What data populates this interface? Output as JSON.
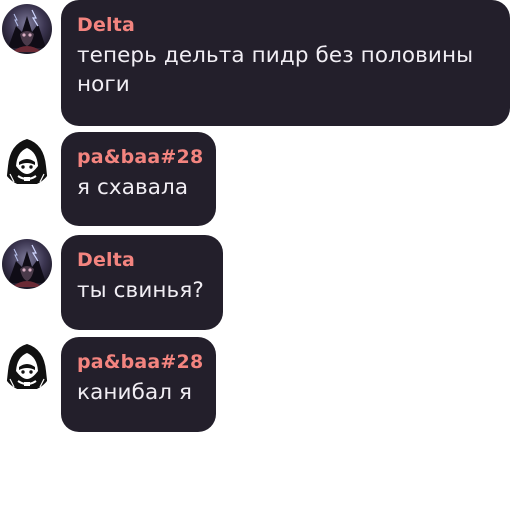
{
  "messages": [
    {
      "author": "Delta",
      "author_color": "#f3847f",
      "avatar_icon": "dark-character-avatar-icon",
      "text": "теперь дельта пидр без половины ноги"
    },
    {
      "author": "pa&baa#28",
      "author_color": "#f3847f",
      "avatar_icon": "hooded-figure-avatar-icon",
      "text": "я схавала"
    },
    {
      "author": "Delta",
      "author_color": "#f3847f",
      "avatar_icon": "dark-character-avatar-icon",
      "text": "ты свинья?"
    },
    {
      "author": "pa&baa#28",
      "author_color": "#f3847f",
      "avatar_icon": "hooded-figure-avatar-icon",
      "text": "канибал я"
    }
  ],
  "colors": {
    "bubble_background": "#231f2b",
    "message_text": "#f1eef4",
    "page_background": "#ffffff"
  }
}
